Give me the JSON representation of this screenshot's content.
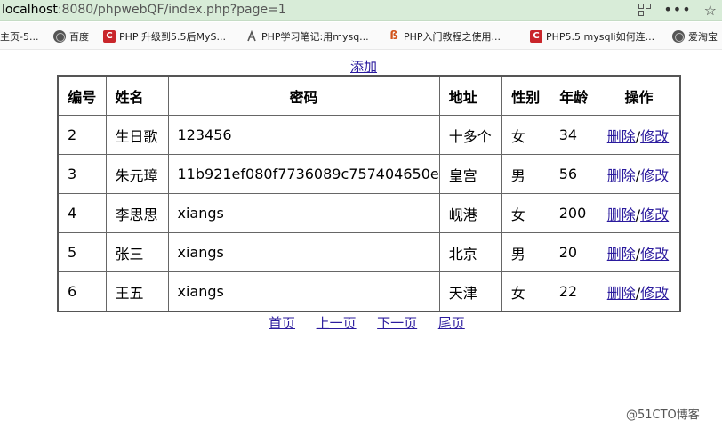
{
  "browser": {
    "url_host": "localhost",
    "url_path": ":8080/phpwebQF/index.php?page=1",
    "qr_icon": "qr-code-icon",
    "menu_label": "•••",
    "star_label": "☆"
  },
  "bookmarks": [
    {
      "label": "主页-5...",
      "icon": "page-icon"
    },
    {
      "label": "百度",
      "icon": "globe-icon"
    },
    {
      "label": "PHP 升级到5.5后MyS...",
      "icon": "csdn-icon"
    },
    {
      "label": "PHP学习笔记:用mysq...",
      "icon": "leaf-icon"
    },
    {
      "label": "PHP入门教程之使用...",
      "icon": "b-icon"
    },
    {
      "label": "PHP5.5 mysqli如何连...",
      "icon": "csdn-icon"
    },
    {
      "label": "爱淘宝",
      "icon": "globe-icon"
    }
  ],
  "add_link": "添加",
  "table": {
    "headers": [
      "编号",
      "姓名",
      "密码",
      "地址",
      "性别",
      "年龄",
      "操作"
    ],
    "rows": [
      {
        "id": "2",
        "name": "生日歌",
        "password": "123456",
        "address": "十多个",
        "gender": "女",
        "age": "34"
      },
      {
        "id": "3",
        "name": "朱元璋",
        "password": "11b921ef080f7736089c757404650e",
        "address": "皇宫",
        "gender": "男",
        "age": "56"
      },
      {
        "id": "4",
        "name": "李思思",
        "password": "xiangs",
        "address": "岘港",
        "gender": "女",
        "age": "200"
      },
      {
        "id": "5",
        "name": "张三",
        "password": "xiangs",
        "address": "北京",
        "gender": "男",
        "age": "20"
      },
      {
        "id": "6",
        "name": "王五",
        "password": "xiangs",
        "address": "天津",
        "gender": "女",
        "age": "22"
      }
    ],
    "delete_label": "删除",
    "separator": "/",
    "edit_label": "修改"
  },
  "pager": {
    "first": "首页",
    "prev": "上一页",
    "next": "下一页",
    "last": "尾页"
  },
  "watermark": "@51CTO博客"
}
